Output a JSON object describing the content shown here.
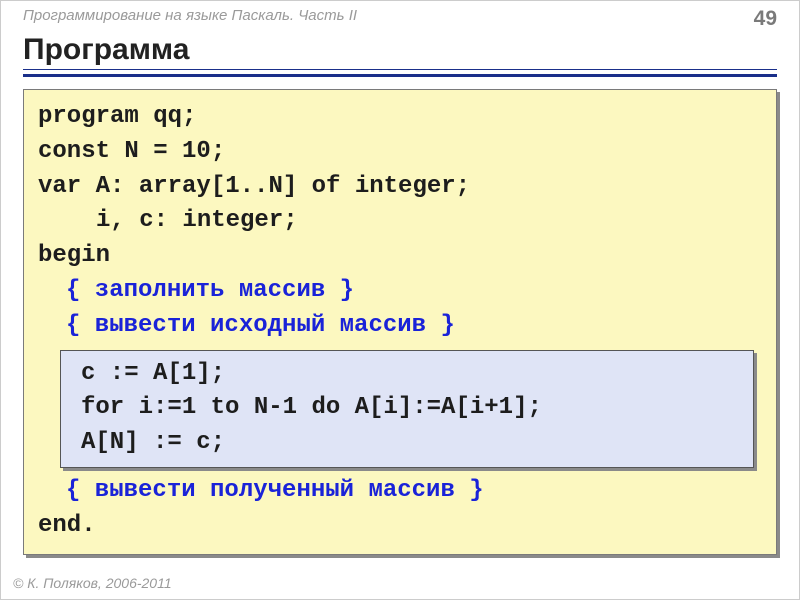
{
  "header": {
    "course": "Программирование на языке Паскаль. Часть II",
    "page": "49"
  },
  "title": "Программа",
  "code": {
    "l1": "program qq;",
    "l2": "const N = 10;",
    "l3": "var A: array[1..N] of integer;",
    "l4": "i, c: integer;",
    "l5": "begin",
    "c1": "{ заполнить массив }",
    "c2": "{ вывести исходный массив }",
    "h1": "c := A[1];",
    "h2": "for i:=1 to N-1 do A[i]:=A[i+1];",
    "h3": "A[N] := c;",
    "c3": "{ вывести полученный массив }",
    "l6": "end."
  },
  "footer": "© К. Поляков, 2006-2011"
}
